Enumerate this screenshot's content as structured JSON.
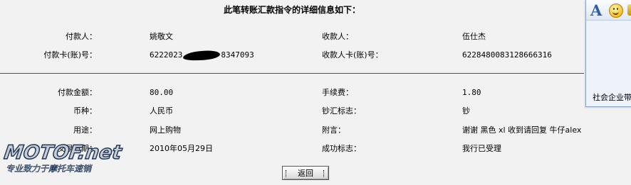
{
  "heading": "此笔转账汇款指令的详细信息如下：",
  "payer": {
    "name_label": "付款人：",
    "name_value": "姚敬文",
    "card_label": "付款卡(账)号：",
    "card_value_prefix": "6222023",
    "card_value_suffix": "8347093"
  },
  "payee": {
    "name_label": "收款人：",
    "name_value": "伍仕杰",
    "card_label": "收款人卡(账)号：",
    "card_value": "6228480083128666316"
  },
  "details": {
    "amount_label": "付款金额：",
    "amount_value": "80.00",
    "fee_label": "手续费：",
    "fee_value": "1.80",
    "currency_label": "币种：",
    "currency_value": "人民币",
    "cash_flag_label": "钞汇标志：",
    "cash_flag_value": "钞",
    "purpose_label": "用途：",
    "purpose_value": "网上购物",
    "remark_label": "附言：",
    "remark_value": "谢谢 黑色 xl 收到请回复 牛仔alex",
    "date_label": "交易日期：",
    "date_value": "2010年05月29日",
    "status_label": "成功标志：",
    "status_value": "我行已受理"
  },
  "actions": {
    "back_label": "返回"
  },
  "side_panel": {
    "font_icon_glyph": "A",
    "text": "社会企业带"
  },
  "watermark": {
    "main": "MOTOF.net",
    "sub": "专业致力于摩托车速销"
  },
  "colors": {
    "background": "#f2f2f2",
    "divider": "#a52a2a"
  }
}
